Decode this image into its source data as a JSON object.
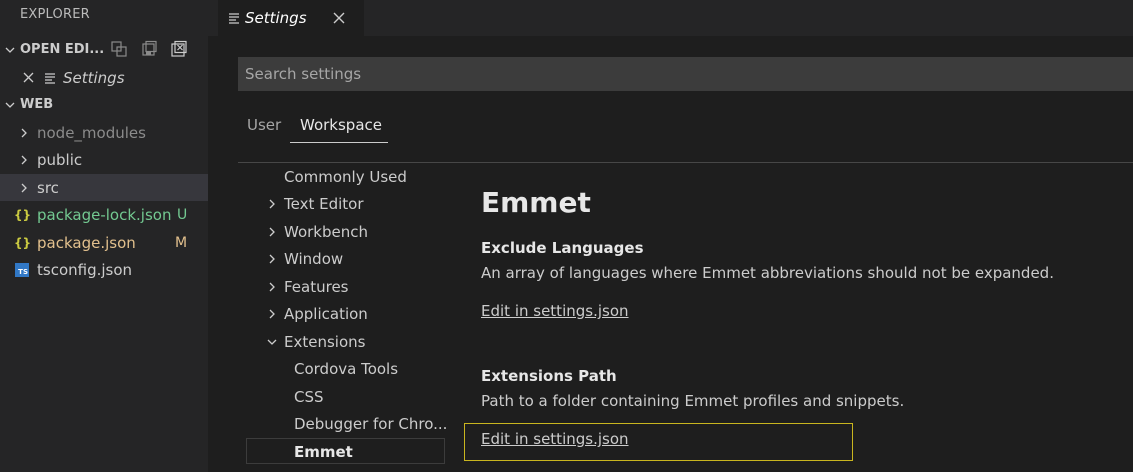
{
  "sidebar": {
    "title": "EXPLORER",
    "open_editors": {
      "label": "OPEN EDI...",
      "items": [
        {
          "label": "Settings"
        }
      ]
    },
    "workspace": {
      "label": "WEB"
    },
    "files": [
      {
        "label": "node_modules",
        "type": "folder"
      },
      {
        "label": "public",
        "type": "folder"
      },
      {
        "label": "src",
        "type": "folder"
      },
      {
        "label": "package-lock.json",
        "type": "json",
        "git": "U"
      },
      {
        "label": "package.json",
        "type": "json",
        "git": "M"
      },
      {
        "label": "tsconfig.json",
        "type": "ts"
      }
    ],
    "icons": {
      "json_glyph": "{}",
      "ts_glyph": "TS"
    }
  },
  "editor": {
    "tab": {
      "label": "Settings",
      "close": "✕"
    },
    "search": {
      "placeholder": "Search settings"
    },
    "scopes": [
      {
        "label": "User"
      },
      {
        "label": "Workspace"
      }
    ],
    "toc": [
      {
        "label": "Commonly Used"
      },
      {
        "label": "Text Editor"
      },
      {
        "label": "Workbench"
      },
      {
        "label": "Window"
      },
      {
        "label": "Features"
      },
      {
        "label": "Application"
      },
      {
        "label": "Extensions"
      },
      {
        "label": "Cordova Tools"
      },
      {
        "label": "CSS"
      },
      {
        "label": "Debugger for Chro..."
      },
      {
        "label": "Emmet"
      }
    ],
    "content": {
      "heading": "Emmet",
      "settings": [
        {
          "title": "Exclude Languages",
          "description": "An array of languages where Emmet abbreviations should not be expanded.",
          "link": "Edit in settings.json"
        },
        {
          "title": "Extensions Path",
          "description": "Path to a folder containing Emmet profiles and snippets.",
          "link": "Edit in settings.json"
        }
      ]
    }
  },
  "colors": {
    "git_untracked": "#73c991",
    "git_modified": "#e2c08d",
    "focus_border": "#c9b51f",
    "ts_icon": "#3178c6",
    "json_icon": "#cbcb41"
  }
}
